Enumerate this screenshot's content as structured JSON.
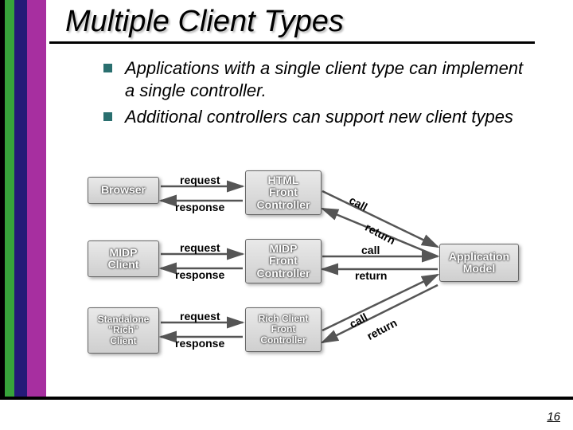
{
  "slide": {
    "title": "Multiple Client Types",
    "page_number": "16",
    "bullets": [
      "Applications with a single client type can implement a single controller.",
      "Additional controllers can support new client types"
    ]
  },
  "diagram": {
    "clients": [
      {
        "label": "Browser"
      },
      {
        "label": "MIDP\nClient"
      },
      {
        "label": "Standalone\n\"Rich\"\nClient"
      }
    ],
    "controllers": [
      {
        "label": "HTML\nFront\nController"
      },
      {
        "label": "MIDP\nFront\nController"
      },
      {
        "label": "Rich Client\nFront\nController"
      }
    ],
    "model": {
      "label": "Application\nModel"
    },
    "edge_labels": {
      "request": "request",
      "response": "response",
      "call": "call",
      "return": "return"
    }
  }
}
